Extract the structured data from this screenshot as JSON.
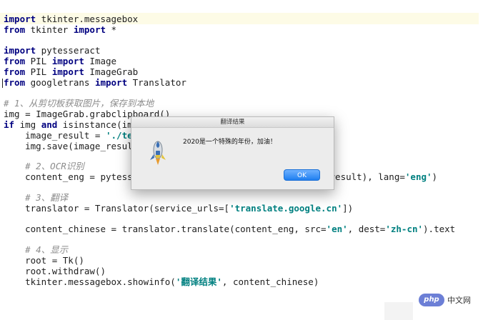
{
  "code": {
    "line1": {
      "kw1": "import",
      "rest": " tkinter.messagebox"
    },
    "line2": {
      "kw1": "from",
      "a": " tkinter ",
      "kw2": "import",
      "b": " *"
    },
    "line3": {
      "kw1": "import",
      "rest": " pytesseract"
    },
    "line4": {
      "kw1": "from",
      "a": " PIL ",
      "kw2": "import",
      "b": " Image"
    },
    "line5": {
      "kw1": "from",
      "a": " PIL ",
      "kw2": "import",
      "b": " ImageGrab"
    },
    "line6": {
      "kw1": "from",
      "a": " googletrans ",
      "kw2": "import",
      "b": " Translator"
    },
    "comment1": "# 1、从剪切板获取图片，保存到本地",
    "line7": "img = ImageGrab.grabclipboard()",
    "line8": {
      "kw1": "if",
      "a": " img ",
      "kw2": "and",
      "b": " isinstance(im"
    },
    "line9": {
      "a": "    image_result = ",
      "str": "'./te"
    },
    "line10": "    img.save(image_resul",
    "comment2": "    # 2、OCR识别",
    "line11": {
      "a": "    content_eng = pytess",
      "b": "_result), lang=",
      "str": "'eng'",
      "c": ")"
    },
    "comment3": "    # 3、翻译",
    "line12": {
      "a": "    translator = Translator(service_urls=[",
      "str": "'translate.google.cn'",
      "b": "])"
    },
    "line13": {
      "a": "    content_chinese = translator.translate(content_eng, src=",
      "str1": "'en'",
      "b": ", dest=",
      "str2": "'zh-cn'",
      "c": ").text"
    },
    "comment4": "    # 4、显示",
    "line14": "    root = Tk()",
    "line15": "    root.withdraw()",
    "line16": {
      "a": "    tkinter.messagebox.showinfo(",
      "str": "'翻译结果'",
      "b": ", content_chinese)"
    }
  },
  "dialog": {
    "title": "翻译结果",
    "message": "2020是一个特殊的年份，加油！",
    "ok_label": "OK",
    "icon": "python-rocket-icon"
  },
  "watermark": {
    "pill": "php",
    "text": "中文网"
  },
  "colors": {
    "keyword": "#000080",
    "string": "#008080",
    "comment": "#8c8c8c",
    "ok_button": "#1f7ff0"
  }
}
